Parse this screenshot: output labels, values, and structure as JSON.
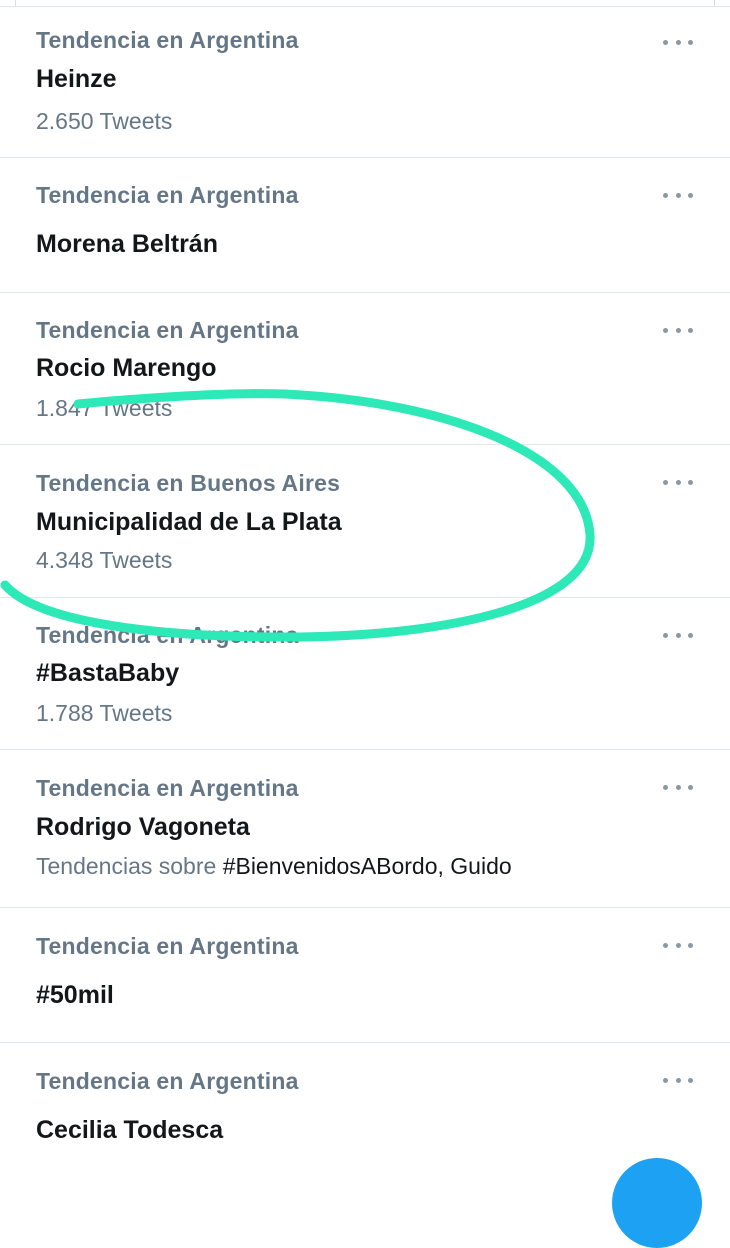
{
  "trends": [
    {
      "context": "Tendencia en Argentina",
      "name": "Heinze",
      "meta": "2.650 Tweets"
    },
    {
      "context": "Tendencia en Argentina",
      "name": "Morena Beltrán",
      "meta": ""
    },
    {
      "context": "Tendencia en Argentina",
      "name": "Rocio Marengo",
      "meta": "1.847 Tweets"
    },
    {
      "context": "Tendencia en Buenos Aires",
      "name": "Municipalidad de La Plata",
      "meta": "4.348 Tweets"
    },
    {
      "context": "Tendencia en Argentina",
      "name": "#BastaBaby",
      "meta": "1.788 Tweets"
    },
    {
      "context": "Tendencia en Argentina",
      "name": "Rodrigo Vagoneta",
      "meta_prefix": "Tendencias sobre ",
      "meta_highlight": "#BienvenidosABordo, Guido"
    },
    {
      "context": "Tendencia en Argentina",
      "name": "#50mil",
      "meta": ""
    },
    {
      "context": "Tendencia en Argentina",
      "name": "Cecilia Todesca",
      "meta": ""
    }
  ],
  "annotation": {
    "color": "#2de8b7"
  },
  "icons": {
    "more": "more-horizontal-icon",
    "compose": "compose-fab-icon"
  },
  "colors": {
    "accent": "#1da1f2",
    "secondary_text": "#657786",
    "primary_text": "#14171a",
    "divider": "#e1e8ed"
  }
}
